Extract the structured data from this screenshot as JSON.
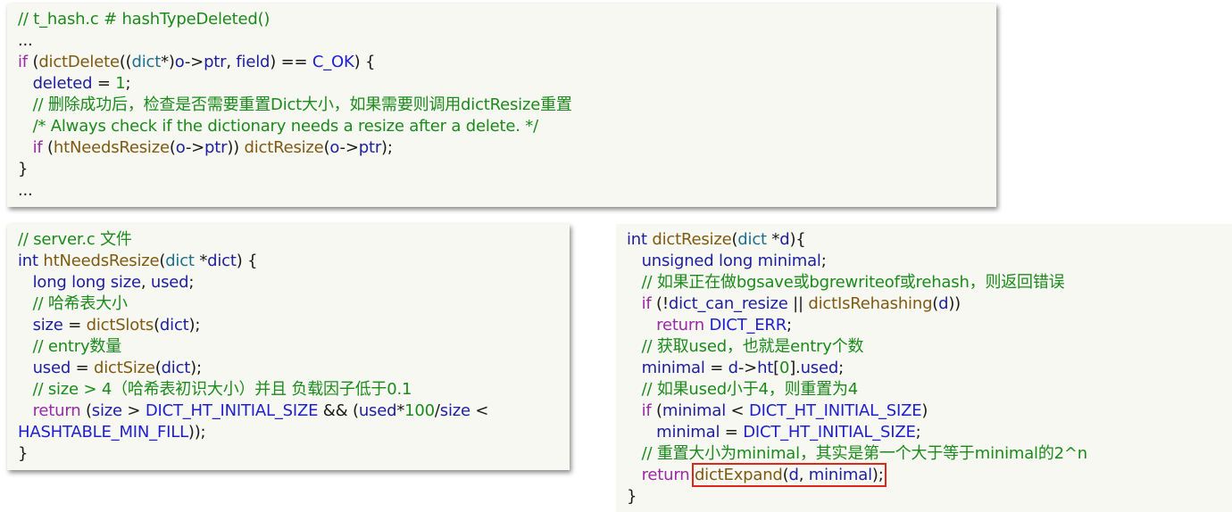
{
  "colors": {
    "panel_background": "#f6f8f1",
    "keyword": "#9b2aa6",
    "comment": "#1c8a1c",
    "function": "#7f5a12",
    "identifier": "#1f1f9e",
    "macro": "#1f1fd0",
    "highlight_border": "#e0251b"
  },
  "panels": [
    {
      "name": "hash-type-deleted-snippet",
      "lines": [
        [
          [
            "comment",
            "// t_hash.c # hashTypeDeleted()"
          ]
        ],
        [
          [
            "punct",
            "..."
          ]
        ],
        [
          [
            "kw",
            "if"
          ],
          [
            "punct",
            " ("
          ],
          [
            "func",
            "dictDelete"
          ],
          [
            "punct",
            "(("
          ],
          [
            "param",
            "dict"
          ],
          [
            "punct",
            "*)"
          ],
          [
            "plain",
            "o"
          ],
          [
            "punct",
            "->"
          ],
          [
            "plain",
            "ptr"
          ],
          [
            "punct",
            ", "
          ],
          [
            "plain",
            "field"
          ],
          [
            "punct",
            ") == "
          ],
          [
            "macro",
            "C_OK"
          ],
          [
            "punct",
            ") {"
          ]
        ],
        [
          [
            "punct",
            "   "
          ],
          [
            "plain",
            "deleted"
          ],
          [
            "punct",
            " = "
          ],
          [
            "num",
            "1"
          ],
          [
            "punct",
            ";"
          ]
        ],
        [
          [
            "punct",
            "   "
          ],
          [
            "comment",
            "// 删除成功后，检查是否需要重置Dict大小，如果需要则调用dictResize重置"
          ]
        ],
        [
          [
            "punct",
            "   "
          ],
          [
            "comment",
            "/* Always check if the dictionary needs a resize after a delete. */"
          ]
        ],
        [
          [
            "punct",
            "   "
          ],
          [
            "kw",
            "if"
          ],
          [
            "punct",
            " ("
          ],
          [
            "func",
            "htNeedsResize"
          ],
          [
            "punct",
            "("
          ],
          [
            "plain",
            "o"
          ],
          [
            "punct",
            "->"
          ],
          [
            "plain",
            "ptr"
          ],
          [
            "punct",
            ")) "
          ],
          [
            "func",
            "dictResize"
          ],
          [
            "punct",
            "("
          ],
          [
            "plain",
            "o"
          ],
          [
            "punct",
            "->"
          ],
          [
            "plain",
            "ptr"
          ],
          [
            "punct",
            ");"
          ]
        ],
        [
          [
            "punct",
            "}"
          ]
        ],
        [
          [
            "punct",
            "..."
          ]
        ]
      ]
    },
    {
      "name": "ht-needs-resize-snippet",
      "lines": [
        [
          [
            "comment",
            "// server.c 文件"
          ]
        ],
        [
          [
            "type",
            "int"
          ],
          [
            "punct",
            " "
          ],
          [
            "func",
            "htNeedsResize"
          ],
          [
            "punct",
            "("
          ],
          [
            "param",
            "dict"
          ],
          [
            "punct",
            " *"
          ],
          [
            "plain",
            "dict"
          ],
          [
            "punct",
            ") {"
          ]
        ],
        [
          [
            "punct",
            "   "
          ],
          [
            "type",
            "long long"
          ],
          [
            "punct",
            " "
          ],
          [
            "plain",
            "size"
          ],
          [
            "punct",
            ", "
          ],
          [
            "plain",
            "used"
          ],
          [
            "punct",
            ";"
          ]
        ],
        [
          [
            "punct",
            "   "
          ],
          [
            "comment",
            "// 哈希表大小"
          ]
        ],
        [
          [
            "punct",
            "   "
          ],
          [
            "plain",
            "size"
          ],
          [
            "punct",
            " = "
          ],
          [
            "func",
            "dictSlots"
          ],
          [
            "punct",
            "("
          ],
          [
            "plain",
            "dict"
          ],
          [
            "punct",
            ");"
          ]
        ],
        [
          [
            "punct",
            "   "
          ],
          [
            "comment",
            "// entry数量"
          ]
        ],
        [
          [
            "punct",
            "   "
          ],
          [
            "plain",
            "used"
          ],
          [
            "punct",
            " = "
          ],
          [
            "func",
            "dictSize"
          ],
          [
            "punct",
            "("
          ],
          [
            "plain",
            "dict"
          ],
          [
            "punct",
            ");"
          ]
        ],
        [
          [
            "punct",
            "   "
          ],
          [
            "comment",
            "// size > 4（哈希表初识大小）并且 负载因子低于0.1"
          ]
        ],
        [
          [
            "punct",
            "   "
          ],
          [
            "kw",
            "return"
          ],
          [
            "punct",
            " ("
          ],
          [
            "plain",
            "size"
          ],
          [
            "punct",
            " > "
          ],
          [
            "macro",
            "DICT_HT_INITIAL_SIZE"
          ],
          [
            "punct",
            " && ("
          ],
          [
            "plain",
            "used"
          ],
          [
            "punct",
            "*"
          ],
          [
            "num",
            "100"
          ],
          [
            "punct",
            "/"
          ],
          [
            "plain",
            "size"
          ],
          [
            "punct",
            " <"
          ]
        ],
        [
          [
            "macro",
            "HASHTABLE_MIN_FILL"
          ],
          [
            "punct",
            "));"
          ]
        ],
        [
          [
            "punct",
            "}"
          ]
        ]
      ]
    },
    {
      "name": "dict-resize-snippet",
      "lines": [
        [
          [
            "type",
            "int"
          ],
          [
            "punct",
            " "
          ],
          [
            "func",
            "dictResize"
          ],
          [
            "punct",
            "("
          ],
          [
            "param",
            "dict"
          ],
          [
            "punct",
            " *"
          ],
          [
            "plain",
            "d"
          ],
          [
            "punct",
            "){"
          ]
        ],
        [
          [
            "punct",
            "   "
          ],
          [
            "type",
            "unsigned long"
          ],
          [
            "punct",
            " "
          ],
          [
            "plain",
            "minimal"
          ],
          [
            "punct",
            ";"
          ]
        ],
        [
          [
            "punct",
            "   "
          ],
          [
            "comment",
            "// 如果正在做bgsave或bgrewriteof或rehash，则返回错误"
          ]
        ],
        [
          [
            "punct",
            "   "
          ],
          [
            "kw",
            "if"
          ],
          [
            "punct",
            " (!"
          ],
          [
            "plain",
            "dict_can_resize"
          ],
          [
            "punct",
            " || "
          ],
          [
            "func",
            "dictIsRehashing"
          ],
          [
            "punct",
            "("
          ],
          [
            "plain",
            "d"
          ],
          [
            "punct",
            "))"
          ]
        ],
        [
          [
            "punct",
            "      "
          ],
          [
            "kw",
            "return"
          ],
          [
            "punct",
            " "
          ],
          [
            "macro",
            "DICT_ERR"
          ],
          [
            "punct",
            ";"
          ]
        ],
        [
          [
            "punct",
            "   "
          ],
          [
            "comment",
            "// 获取used，也就是entry个数"
          ]
        ],
        [
          [
            "punct",
            "   "
          ],
          [
            "plain",
            "minimal"
          ],
          [
            "punct",
            " = "
          ],
          [
            "plain",
            "d"
          ],
          [
            "punct",
            "->"
          ],
          [
            "plain",
            "ht"
          ],
          [
            "punct",
            "["
          ],
          [
            "num",
            "0"
          ],
          [
            "punct",
            "]."
          ],
          [
            "plain",
            "used"
          ],
          [
            "punct",
            ";"
          ]
        ],
        [
          [
            "punct",
            "   "
          ],
          [
            "comment",
            "// 如果used小于4，则重置为4"
          ]
        ],
        [
          [
            "punct",
            "   "
          ],
          [
            "kw",
            "if"
          ],
          [
            "punct",
            " ("
          ],
          [
            "plain",
            "minimal"
          ],
          [
            "punct",
            " < "
          ],
          [
            "macro",
            "DICT_HT_INITIAL_SIZE"
          ],
          [
            "punct",
            ")"
          ]
        ],
        [
          [
            "punct",
            "      "
          ],
          [
            "plain",
            "minimal"
          ],
          [
            "punct",
            " = "
          ],
          [
            "macro",
            "DICT_HT_INITIAL_SIZE"
          ],
          [
            "punct",
            ";"
          ]
        ],
        [
          [
            "punct",
            "   "
          ],
          [
            "comment",
            "// 重置大小为minimal，其实是第一个大于等于minimal的2^n"
          ]
        ],
        [
          [
            "punct",
            "   "
          ],
          [
            "kw",
            "return"
          ],
          [
            "punct",
            " "
          ],
          [
            "func",
            "dictExpand",
            "hl-start"
          ],
          [
            "punct",
            "("
          ],
          [
            "plain",
            "d"
          ],
          [
            "punct",
            ", "
          ],
          [
            "plain",
            "minimal"
          ],
          [
            "punct",
            ");",
            "hl-end"
          ]
        ],
        [
          [
            "punct",
            "}"
          ]
        ]
      ]
    }
  ]
}
